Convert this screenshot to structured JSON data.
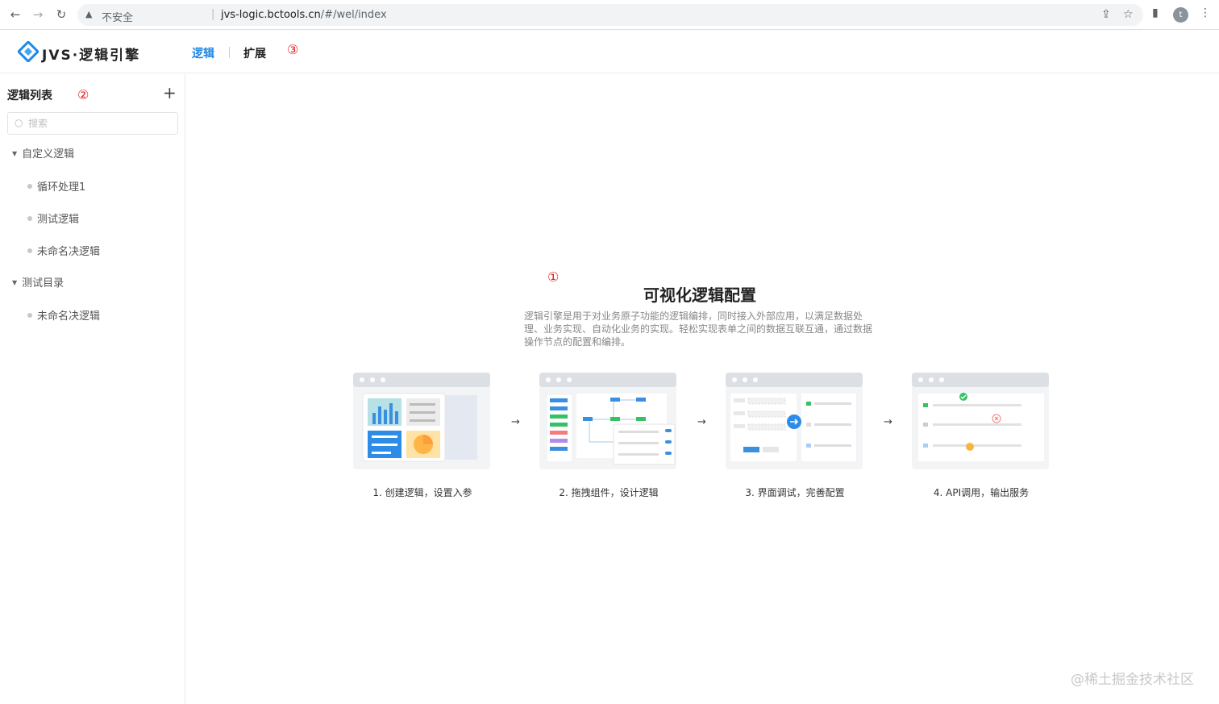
{
  "browser": {
    "security_label": "不安全",
    "url_host": "jvs-logic.bctools.cn",
    "url_path": "/#/wel/index",
    "profile_initial": "t"
  },
  "header": {
    "brand": "JVS·逻辑引擎",
    "tabs": [
      "逻辑",
      "扩展"
    ],
    "active_tab": "逻辑",
    "accent_color": "#1e88e5"
  },
  "markers": [
    "①",
    "②",
    "③"
  ],
  "sidebar": {
    "title": "逻辑列表",
    "add_label": "+",
    "search_placeholder": "搜索",
    "folders": [
      {
        "label": "自定义逻辑",
        "items": [
          "循环处理1",
          "测试逻辑",
          "未命名决逻辑"
        ]
      },
      {
        "label": "测试目录",
        "items": [
          "未命名决逻辑"
        ]
      }
    ]
  },
  "main": {
    "title": "可视化逻辑配置",
    "description": "逻辑引擎是用于对业务原子功能的逻辑编排，同时接入外部应用，以满足数据处理、业务实现、自动化业务的实现。轻松实现表单之间的数据互联互通，通过数据操作节点的配置和编排。",
    "steps": [
      "1. 创建逻辑，设置入参",
      "2. 拖拽组件，设计逻辑",
      "3. 界面调试，完善配置",
      "4. API调用，输出服务"
    ]
  },
  "watermark": "@稀土掘金技术社区"
}
